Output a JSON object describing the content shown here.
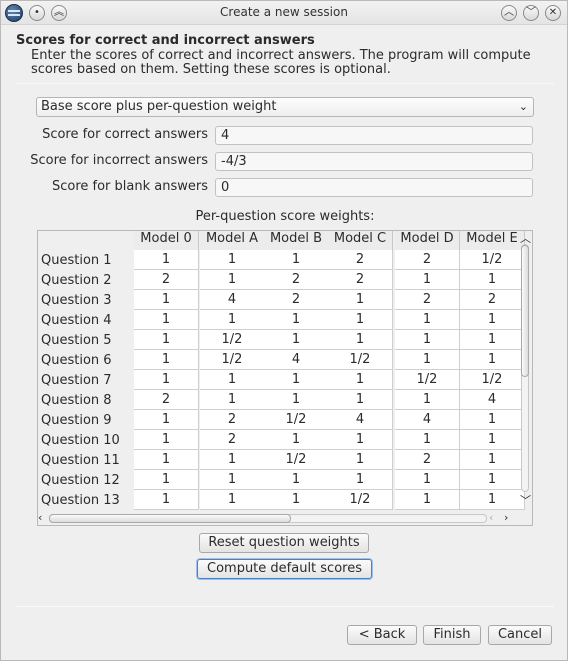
{
  "window": {
    "title": "Create a new session"
  },
  "header": {
    "title": "Scores for correct and incorrect answers",
    "description_line1": "Enter the scores of correct and incorrect answers. The program will compute",
    "description_line2": "scores based on them. Setting these scores is optional."
  },
  "scoring": {
    "mode_selected": "Base score plus per-question weight",
    "correct_label": "Score for correct answers",
    "correct_value": "4",
    "incorrect_label": "Score for incorrect answers",
    "incorrect_value": "-4/3",
    "blank_label": "Score for blank answers",
    "blank_value": "0"
  },
  "weights": {
    "caption": "Per-question score weights:",
    "columns": [
      "Model 0",
      "Model A",
      "Model B",
      "Model C",
      "Model D",
      "Model E"
    ],
    "rows": [
      {
        "label": "Question 1",
        "values": [
          "1",
          "1",
          "1",
          "2",
          "2",
          "1/2"
        ]
      },
      {
        "label": "Question 2",
        "values": [
          "2",
          "1",
          "2",
          "2",
          "1",
          "1"
        ]
      },
      {
        "label": "Question 3",
        "values": [
          "1",
          "4",
          "2",
          "1",
          "2",
          "2"
        ]
      },
      {
        "label": "Question 4",
        "values": [
          "1",
          "1",
          "1",
          "1",
          "1",
          "1"
        ]
      },
      {
        "label": "Question 5",
        "values": [
          "1",
          "1/2",
          "1",
          "1",
          "1",
          "1"
        ]
      },
      {
        "label": "Question 6",
        "values": [
          "1",
          "1/2",
          "4",
          "1/2",
          "1",
          "1"
        ]
      },
      {
        "label": "Question 7",
        "values": [
          "1",
          "1",
          "1",
          "1",
          "1/2",
          "1/2"
        ]
      },
      {
        "label": "Question 8",
        "values": [
          "2",
          "1",
          "1",
          "1",
          "1",
          "4"
        ]
      },
      {
        "label": "Question 9",
        "values": [
          "1",
          "2",
          "1/2",
          "4",
          "4",
          "1"
        ]
      },
      {
        "label": "Question 10",
        "values": [
          "1",
          "2",
          "1",
          "1",
          "1",
          "1"
        ]
      },
      {
        "label": "Question 11",
        "values": [
          "1",
          "1",
          "1/2",
          "1",
          "2",
          "1"
        ]
      },
      {
        "label": "Question 12",
        "values": [
          "1",
          "1",
          "1",
          "1",
          "1",
          "1"
        ]
      },
      {
        "label": "Question 13",
        "values": [
          "1",
          "1",
          "1",
          "1/2",
          "1",
          "1"
        ]
      }
    ],
    "reset_button": "Reset question weights",
    "compute_button": "Compute default scores"
  },
  "footer": {
    "back": "< Back",
    "finish": "Finish",
    "cancel": "Cancel"
  },
  "icons": {
    "app": "app-icon",
    "title_buttons_left": [
      "help-icon",
      "keep-above-icon"
    ],
    "title_buttons_right": [
      "shade-icon",
      "minimize-icon",
      "close-icon"
    ]
  }
}
